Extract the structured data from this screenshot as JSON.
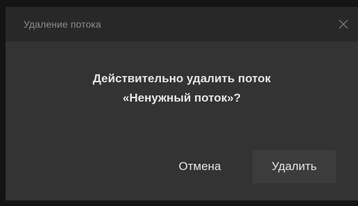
{
  "dialog": {
    "title": "Удаление потока",
    "message_line1": "Действительно удалить поток",
    "message_line2": "«Ненужный поток»?",
    "cancel_label": "Отмена",
    "delete_label": "Удалить",
    "close_icon": "close-icon"
  },
  "colors": {
    "background": "#141414",
    "dialog_body": "#333333",
    "title_bar": "#282828",
    "delete_button": "#3c3c3c",
    "text": "#e6e6e6",
    "muted_text": "#8e8e8e"
  }
}
